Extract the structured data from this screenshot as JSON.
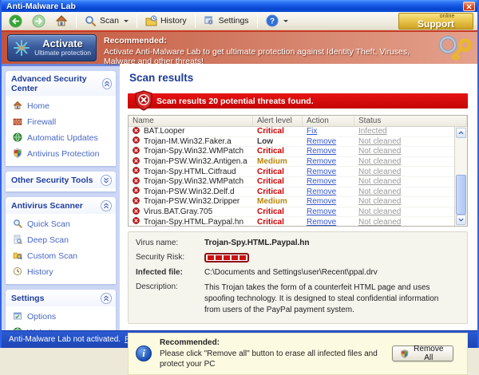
{
  "window": {
    "title": "Anti-Malware Lab"
  },
  "toolbar": {
    "scan_label": "Scan",
    "history_label": "History",
    "settings_label": "Settings",
    "help_glyph": "?",
    "support_line1": "online",
    "support_line2": "Support"
  },
  "banner": {
    "activate_label": "Activate",
    "activate_sub": "Ultimate protection",
    "recommended_label": "Recommended:",
    "message": "Activate Anti-Malware Lab to get ultimate protection against Identity Theft, Viruses, Malware and other threats!"
  },
  "sidebar": {
    "sections": [
      {
        "title": "Advanced Security Center",
        "collapsed": false,
        "items": [
          {
            "label": "Home",
            "icon": "home-icon"
          },
          {
            "label": "Firewall",
            "icon": "firewall-icon"
          },
          {
            "label": "Automatic Updates",
            "icon": "updates-icon"
          },
          {
            "label": "Antivirus Protection",
            "icon": "shield-icon"
          }
        ]
      },
      {
        "title": "Other Security Tools",
        "collapsed": true,
        "items": []
      },
      {
        "title": "Antivirus Scanner",
        "collapsed": false,
        "items": [
          {
            "label": "Quick Scan",
            "icon": "magnifier-icon"
          },
          {
            "label": "Deep Scan",
            "icon": "document-scan-icon"
          },
          {
            "label": "Custom Scan",
            "icon": "folder-scan-icon"
          },
          {
            "label": "History",
            "icon": "clock-icon"
          }
        ]
      },
      {
        "title": "Settings",
        "collapsed": false,
        "items": [
          {
            "label": "Options",
            "icon": "options-icon"
          },
          {
            "label": "Website",
            "icon": "globe-icon"
          }
        ]
      }
    ]
  },
  "main": {
    "heading": "Scan results",
    "alert_text": "Scan results 20 potential threats found.",
    "table": {
      "columns": [
        "Name",
        "Alert level",
        "Action",
        "Status"
      ],
      "rows": [
        {
          "name": "BAT.Looper",
          "alert": "Critical",
          "action": "Fix",
          "status": "Infected"
        },
        {
          "name": "Trojan-IM.Win32.Faker.a",
          "alert": "Low",
          "action": "Remove",
          "status": "Not cleaned"
        },
        {
          "name": "Trojan-Spy.Win32.WMPatch",
          "alert": "Critical",
          "action": "Remove",
          "status": "Not cleaned"
        },
        {
          "name": "Trojan-PSW.Win32.Antigen.a",
          "alert": "Medium",
          "action": "Remove",
          "status": "Not cleaned"
        },
        {
          "name": "Trojan-Spy.HTML.Citfraud",
          "alert": "Critical",
          "action": "Remove",
          "status": "Not cleaned"
        },
        {
          "name": "Trojan-Spy.Win32.WMPatch",
          "alert": "Critical",
          "action": "Remove",
          "status": "Not cleaned"
        },
        {
          "name": "Trojan-PSW.Win32.Delf.d",
          "alert": "Critical",
          "action": "Remove",
          "status": "Not cleaned"
        },
        {
          "name": "Trojan-PSW.Win32.Dripper",
          "alert": "Medium",
          "action": "Remove",
          "status": "Not cleaned"
        },
        {
          "name": "Virus.BAT.Gray.705",
          "alert": "Critical",
          "action": "Remove",
          "status": "Not cleaned"
        },
        {
          "name": "Trojan-Spy.HTML.Paypal.hn",
          "alert": "Critical",
          "action": "Remove",
          "status": "Not cleaned"
        }
      ]
    },
    "details": {
      "virus_name_label": "Virus name:",
      "virus_name": "Trojan-Spy.HTML.Paypal.hn",
      "security_risk_label": "Security Risk:",
      "security_risk_segments": 5,
      "infected_file_label": "Infected file:",
      "infected_file": "C:\\Documents and Settings\\user\\Recent\\ppal.drv",
      "description_label": "Description:",
      "description": "This Trojan takes the form of a counterfeit HTML page and uses spoofing technology. It is designed to steal confidential information from users of the PayPal payment system."
    },
    "recommended": {
      "info_glyph": "i",
      "title": "Recommended:",
      "text": "Please click \"Remove all\" button to erase all infected files and protect your PC",
      "button_label": "Remove All"
    }
  },
  "statusbar": {
    "text": "Anti-Malware Lab not activated.",
    "link": "Plese activate to get ultimate protection."
  },
  "colors": {
    "accent_red": "#CE0000",
    "medium_yellow": "#B8860B",
    "link_blue": "#3355CC",
    "titlebar_blue": "#0845CE",
    "banner_salmon": "#D0775F",
    "statusbar_blue": "#2353C8"
  }
}
